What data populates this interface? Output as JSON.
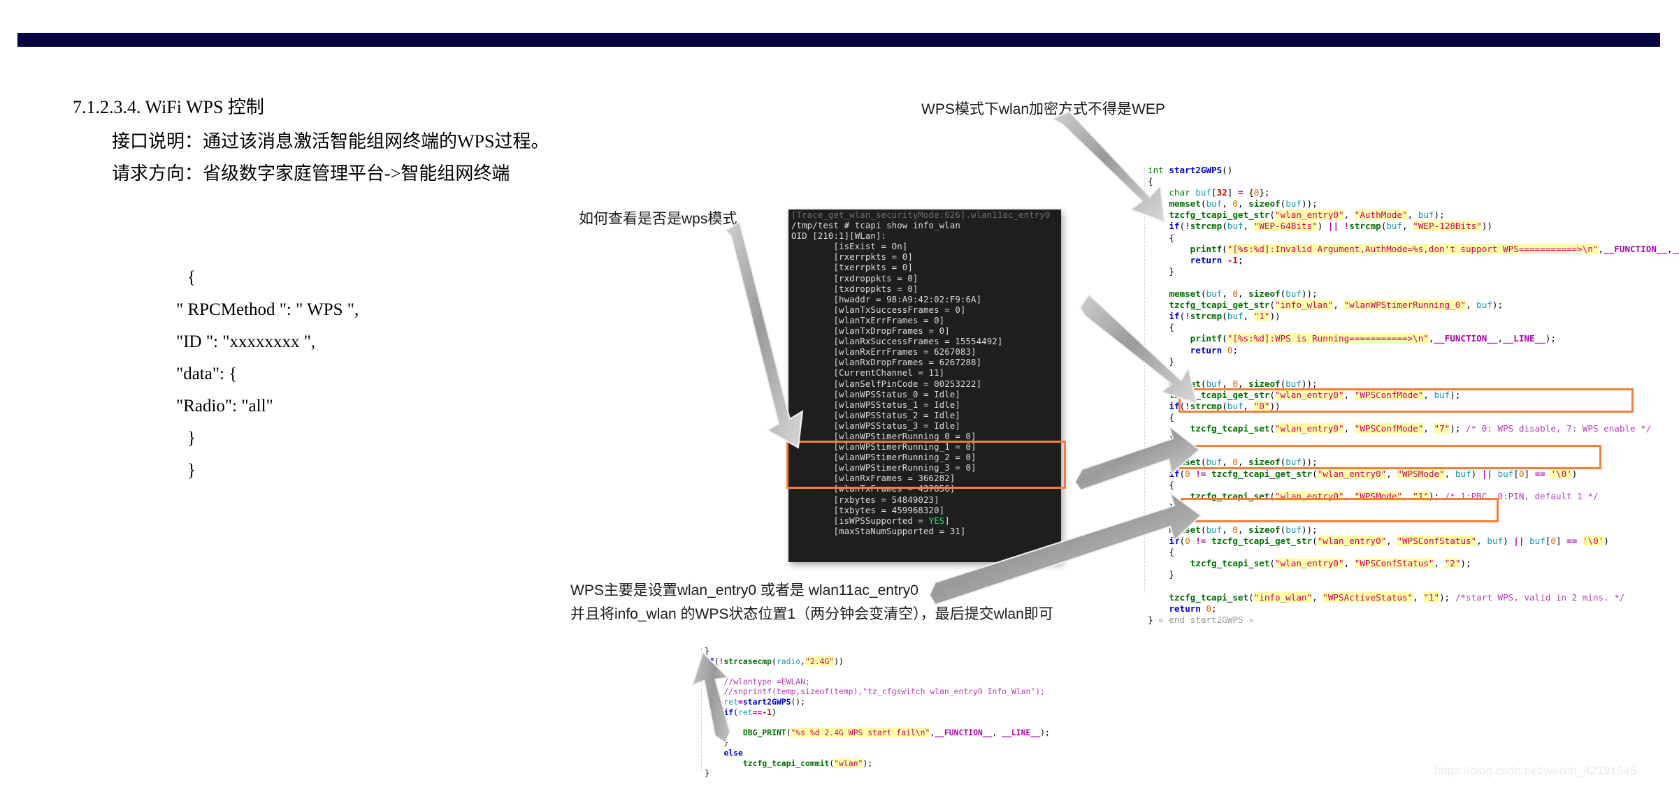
{
  "theme": {
    "navy_bar": "#050542",
    "highlight_orange": "#f0803c",
    "terminal_bg": "#1e1e1e",
    "terminal_fg": "#dcdcdc",
    "terminal_green": "#2ee26e",
    "string_highlight": "#ffffaa"
  },
  "document": {
    "heading": "7.1.2.3.4. WiFi WPS 控制",
    "line_1": "接口说明：通过该消息激活智能组网终端的WPS过程。",
    "line_2": "请求方向：省级数字家庭管理平台->智能组网终端",
    "json_snippet": [
      "{",
      "\" RPCMethod \": \" WPS \",",
      "\"ID \": \"xxxxxxxx \",",
      "\"data\": {",
      "\"Radio\": \"all\"",
      "}",
      "}"
    ]
  },
  "annotations": {
    "wep_note": "WPS模式下wlan加密方式不得是WEP",
    "howto_note": "如何查看是否是wps模式",
    "bottom_note_line1": "WPS主要是设置wlan_entry0 或者是 wlan11ac_entry0",
    "bottom_note_line2": "并且将info_wlan 的WPS状态位置1（两分钟会变清空），最后提交wlan即可"
  },
  "terminal": {
    "clipped_top_line": "[Trace_get_wlan_securityMode:626].wlan11ac_entry0",
    "lines": [
      "/tmp/test # tcapi show info_wlan",
      "OID [210:1][WLan]:",
      "        [isExist = On]",
      "        [rxerrpkts = 0]",
      "        [txerrpkts = 0]",
      "        [rxdroppkts = 0]",
      "        [txdroppkts = 0]",
      "        [hwaddr = 98:A9:42:02:F9:6A]",
      "        [wlanTxSuccessFrames = 0]",
      "        [wlanTxErrFrames = 0]",
      "        [wlanTxDropFrames = 0]",
      "        [wlanRxSuccessFrames = 15554492]",
      "        [wlanRxErrFrames = 6267083]",
      "        [wlanRxDropFrames = 6267288]",
      "        [CurrentChannel = 11]",
      "        [wlanSelfPinCode = 00253222]",
      "        [wlanWPSStatus_0 = Idle]",
      "        [wlanWPSStatus_1 = Idle]",
      "        [wlanWPSStatus_2 = Idle]",
      "        [wlanWPSStatus_3 = Idle]",
      "        [wlanWPStimerRunning_0 = 0]",
      "        [wlanWPStimerRunning_1 = 0]",
      "        [wlanWPStimerRunning_2 = 0]",
      "        [wlanWPStimerRunning_3 = 0]",
      "        [wlanRxFrames = 366282]",
      "        [wlanTxFrames = 437856]",
      "        [rxbytes = 54849023]",
      "        [txbytes = 459968320]",
      "        [isWPSSupported = YES]",
      "        [maxStaNumSupported = 31]"
    ],
    "green_value": "YES",
    "highlighted_lines": [
      "[wlanWPStimerRunning_0 = 0]",
      "[wlanWPStimerRunning_1 = 0]",
      "[wlanWPStimerRunning_2 = 0]",
      "[wlanWPStimerRunning_3 = 0]"
    ]
  },
  "code_main": {
    "function_name": "start2GWPS",
    "fold_marker": "« end start2GWPS »",
    "highlight_boxes": [
      "tzcfg_tcapi_set(\"wlan_entry0\", \"WPSConfMode\", \"7\"); /* 0: WPS disable, 7: WPS enable */",
      "tzcfg_tcapi_set(\"wlan_entry0\", \"WPSMode\", \"1\"); /* 1:PBC, 0:PIN, default 1 */",
      "tzcfg_tcapi_set(\"wlan_entry0\", \"WPSConfStatus\", \"2\");"
    ],
    "plain_lines": [
      "int start2GWPS()",
      "{",
      "    char buf[32] = {0};",
      "    memset(buf, 0, sizeof(buf));",
      "    tzcfg_tcapi_get_str(\"wlan_entry0\", \"AuthMode\", buf);",
      "    if(!strcmp(buf, \"WEP-64Bits\") || !strcmp(buf, \"WEP-128Bits\"))",
      "    {",
      "        printf(\"[%s:%d]:Invalid Argument,AuthMode=%s,don't support WPS===========>\\n\",__FUNCTION__,__LINE__,buf);",
      "        return -1;",
      "    }",
      "",
      "    memset(buf, 0, sizeof(buf));",
      "    tzcfg_tcapi_get_str(\"info_wlan\", \"wlanWPStimerRunning_0\", buf);",
      "    if(!strcmp(buf, \"1\"))",
      "    {",
      "        printf(\"[%s:%d]:WPS is Running===========>\\n\",__FUNCTION__,__LINE__);",
      "        return 0;",
      "    }",
      "",
      "    memset(buf, 0, sizeof(buf));",
      "    tzcfg_tcapi_get_str(\"wlan_entry0\", \"WPSConfMode\", buf);",
      "    if(!strcmp(buf, \"0\"))",
      "    {",
      "        tzcfg_tcapi_set(\"wlan_entry0\", \"WPSConfMode\", \"7\"); /* 0: WPS disable, 7: WPS enable */",
      "    }",
      "",
      "    memset(buf, 0, sizeof(buf));",
      "    if(0 != tzcfg_tcapi_get_str(\"wlan_entry0\", \"WPSMode\", buf) || buf[0] == '\\0')",
      "    {",
      "        tzcfg_tcapi_set(\"wlan_entry0\", \"WPSMode\", \"1\"); /* 1:PBC, 0:PIN, default 1 */",
      "    }",
      "",
      "    memset(buf, 0, sizeof(buf));",
      "    if(0 != tzcfg_tcapi_get_str(\"wlan_entry0\", \"WPSConfStatus\", buf) || buf[0] == '\\0')",
      "    {",
      "        tzcfg_tcapi_set(\"wlan_entry0\", \"WPSConfStatus\", \"2\");",
      "    }",
      "",
      "    tzcfg_tcapi_set(\"info_wlan\", \"WPSActiveStatus\", \"1\"); /*start WPS, valid in 2 mins. */",
      "    return 0;",
      "} « end start2GWPS »"
    ]
  },
  "code_bottom": {
    "lines": [
      "}",
      "if(!strcasecmp(radio,\"2.4G\"))",
      "{",
      "    //wlantype =EWLAN;",
      "    //snprintf(temp,sizeof(temp),\"tz_cfgswitch wlan_entry0 Info_Wlan\");",
      "    ret=start2GWPS();",
      "    if(ret==-1)",
      "    {",
      "        DBG_PRINT(\"%s %d 2.4G WPS start fail\\n\",__FUNCTION__, __LINE__);",
      "    }",
      "    else",
      "        tzcfg_tcapi_commit(\"wlan\");",
      "}"
    ]
  },
  "watermark": "https://blog.csdn.net/weixin_42191545"
}
